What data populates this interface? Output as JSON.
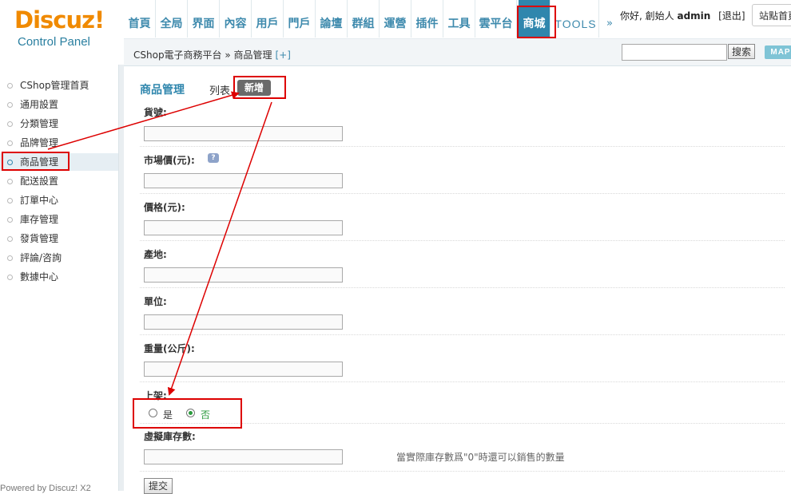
{
  "logo": {
    "brand": "Discuz!",
    "sub": "Control Panel"
  },
  "topnav": {
    "items": [
      {
        "label": "首頁"
      },
      {
        "label": "全局"
      },
      {
        "label": "界面"
      },
      {
        "label": "內容"
      },
      {
        "label": "用戶"
      },
      {
        "label": "門戶"
      },
      {
        "label": "論壇"
      },
      {
        "label": "群組"
      },
      {
        "label": "運營"
      },
      {
        "label": "插件"
      },
      {
        "label": "工具"
      },
      {
        "label": "雲平台"
      },
      {
        "label": "商城"
      },
      {
        "label": "TOOLS"
      }
    ],
    "more": "»",
    "active_index": 12,
    "greeting": "你好, 創始人",
    "username": "admin",
    "logout": "[退出]",
    "site_home": "站點首頁"
  },
  "subbar": {
    "breadcrumb": "CShop電子商務平台 » 商品管理",
    "add_link": "[+]",
    "search_button": "搜索",
    "search_value": "",
    "map_button": "MAP"
  },
  "sidebar": {
    "items": [
      {
        "label": "CShop管理首頁"
      },
      {
        "label": "通用設置"
      },
      {
        "label": "分類管理"
      },
      {
        "label": "品牌管理"
      },
      {
        "label": "商品管理"
      },
      {
        "label": "配送設置"
      },
      {
        "label": "訂單中心"
      },
      {
        "label": "庫存管理"
      },
      {
        "label": "發貨管理"
      },
      {
        "label": "評論/咨詢"
      },
      {
        "label": "數據中心"
      }
    ],
    "active_index": 4,
    "powered": "Powered by Discuz! X2"
  },
  "main": {
    "title": "商品管理",
    "tab_list": "列表",
    "tab_add": "新增",
    "fields": {
      "sku_label": "貨號:",
      "market_price_label": "市場價(元):",
      "price_label": "價格(元):",
      "origin_label": "產地:",
      "unit_label": "單位:",
      "weight_label": "重量(公斤):",
      "on_shelf_label": "上架:",
      "virtual_stock_label": "虛擬庫存數:"
    },
    "hint_icon": "?",
    "radio_yes": "是",
    "radio_no": "否",
    "on_shelf_selected": "否",
    "stock_help": "當實際庫存數爲\"0\"時還可以銷售的數量",
    "submit": "提交"
  },
  "colors": {
    "accent": "#2f86ad",
    "annotation": "#dd0000",
    "brand_orange": "#f08a00"
  }
}
